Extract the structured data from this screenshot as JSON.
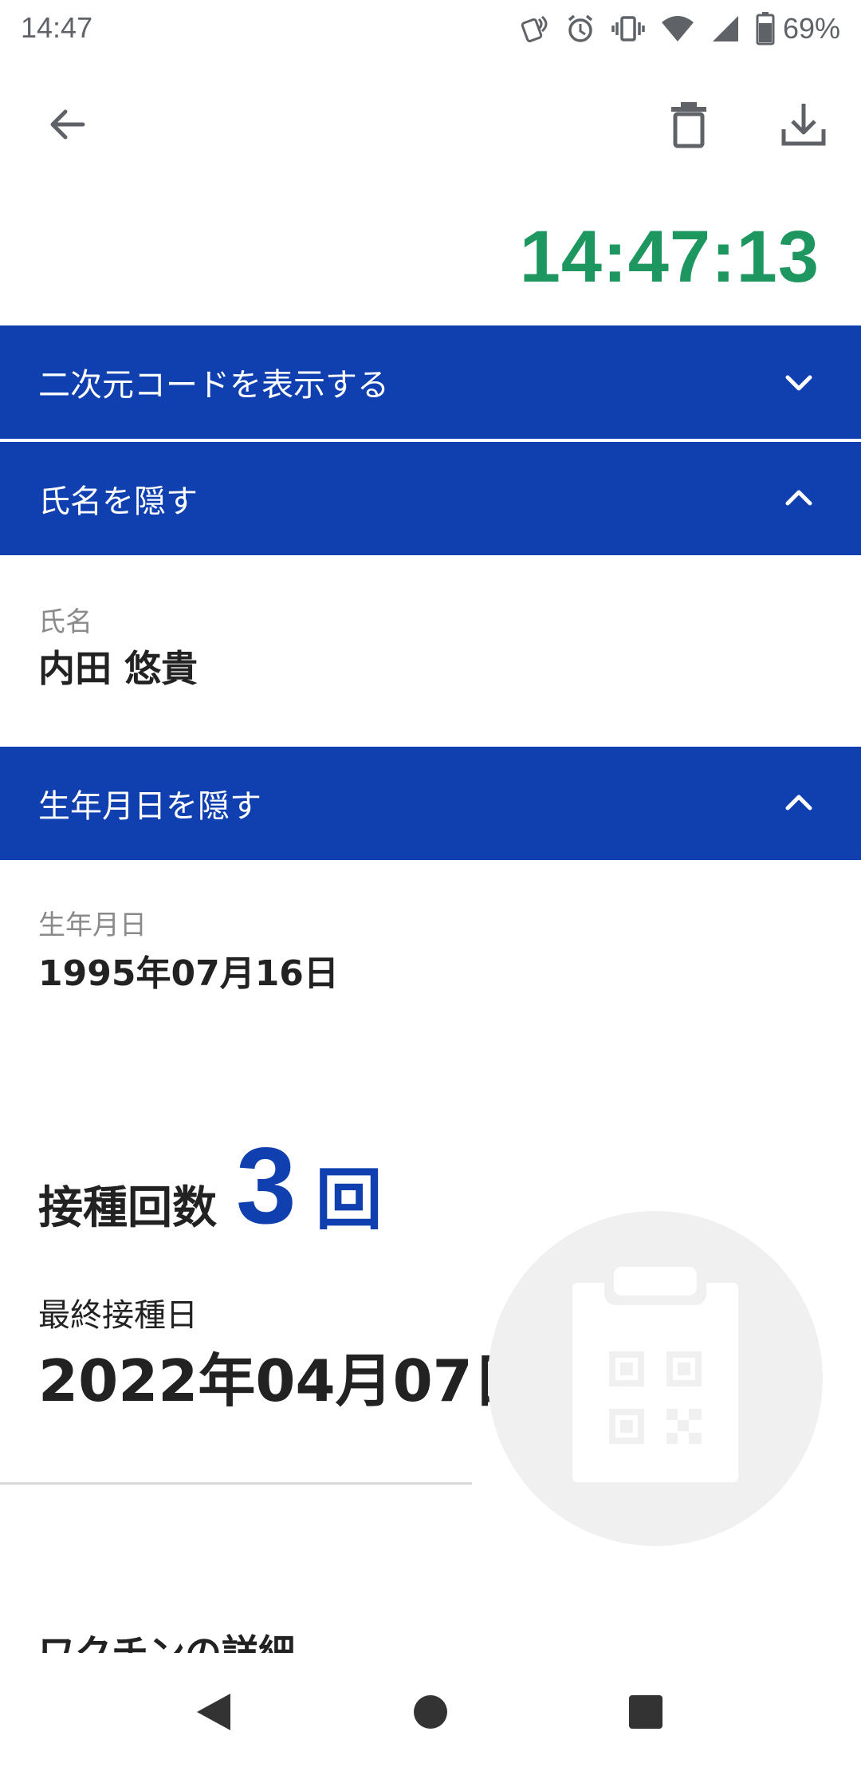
{
  "status_bar": {
    "time": "14:47",
    "battery_percent": "69%",
    "icons": [
      "nfc-icon",
      "alarm-icon",
      "vibrate-icon",
      "wifi-icon",
      "signal-icon",
      "battery-icon"
    ]
  },
  "app_bar": {
    "back_icon": "arrow-back-icon",
    "delete_icon": "trash-icon",
    "download_icon": "download-icon"
  },
  "clock": "14:47:13",
  "sections": {
    "qr": {
      "label": "二次元コードを表示する",
      "state": "collapsed"
    },
    "name": {
      "label": "氏名を隠す",
      "state": "expanded"
    },
    "dob": {
      "label": "生年月日を隠す",
      "state": "expanded"
    }
  },
  "fields": {
    "name_label": "氏名",
    "name_value": "内田 悠貴",
    "dob_label": "生年月日",
    "dob_value": "1995年07月16日"
  },
  "vaccination": {
    "dose_title": "接種回数",
    "dose_count": "3",
    "dose_unit": "回",
    "last_date_label": "最終接種日",
    "last_date_value": "2022年04月07日"
  },
  "details_heading": "ワクチンの詳細",
  "colors": {
    "accent_blue": "#1040b0",
    "clock_green": "#1e9660"
  },
  "nav": {
    "back_icon": "nav-back-icon",
    "home_icon": "nav-home-icon",
    "recents_icon": "nav-recents-icon"
  }
}
